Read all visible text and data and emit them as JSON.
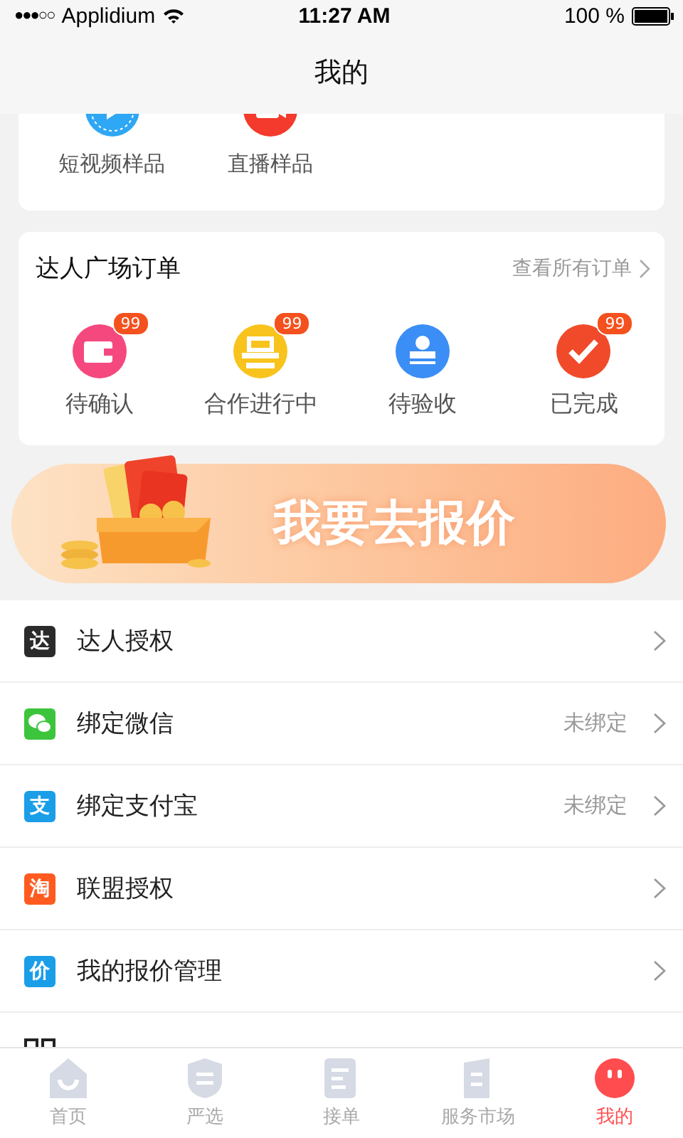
{
  "status_bar": {
    "signal": "●●●○○",
    "carrier": "Applidium",
    "time": "11:27 AM",
    "battery": "100 %"
  },
  "nav": {
    "title": "我的"
  },
  "samples": [
    {
      "label": "短视频样品",
      "kind": "video"
    },
    {
      "label": "直播样品",
      "kind": "live"
    }
  ],
  "orders": {
    "title": "达人广场订单",
    "link": "查看所有订单",
    "items": [
      {
        "label": "待确认",
        "kind": "wallet",
        "badge": "99"
      },
      {
        "label": "合作进行中",
        "kind": "printer",
        "badge": "99"
      },
      {
        "label": "待验收",
        "kind": "stamp"
      },
      {
        "label": "已完成",
        "kind": "check",
        "badge": "99"
      }
    ]
  },
  "banner": {
    "text": "我要去报价"
  },
  "menu": [
    {
      "label": "达人授权",
      "kind": "talent",
      "glyph": "达",
      "chevron": true
    },
    {
      "label": "绑定微信",
      "kind": "wechat",
      "status": "未绑定",
      "chevron": true
    },
    {
      "label": "绑定支付宝",
      "kind": "alipay",
      "glyph": "支",
      "status": "未绑定",
      "chevron": true
    },
    {
      "label": "联盟授权",
      "kind": "taobao",
      "glyph": "淘",
      "chevron": true
    },
    {
      "label": "我的报价管理",
      "kind": "price",
      "glyph": "价",
      "chevron": true
    },
    {
      "kind": "qr",
      "chevron": false
    }
  ],
  "tabs": [
    {
      "label": "首页",
      "kind": "home",
      "selected": false
    },
    {
      "label": "严选",
      "kind": "shield",
      "selected": false
    },
    {
      "label": "接单",
      "kind": "doc",
      "selected": false
    },
    {
      "label": "服务市场",
      "kind": "market",
      "selected": false
    },
    {
      "label": "我的",
      "kind": "me",
      "selected": true
    }
  ]
}
